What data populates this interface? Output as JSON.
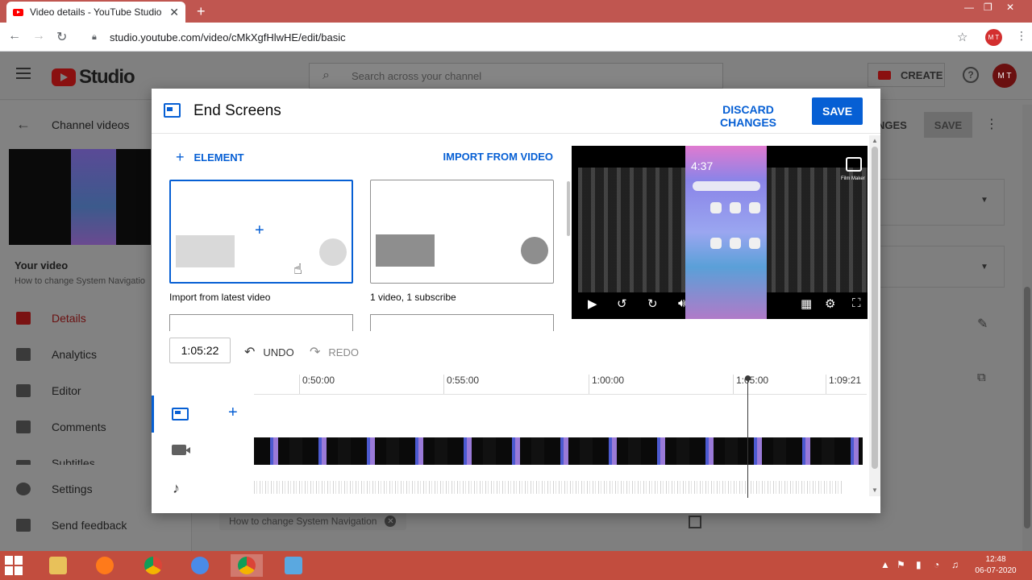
{
  "browser": {
    "tab_title": "Video details - YouTube Studio",
    "tab_close": "✕",
    "new_tab": "+",
    "url": "studio.youtube.com/video/cMkXgfHlwHE/edit/basic",
    "profile_initials": "M T"
  },
  "studio": {
    "logo_text": "Studio",
    "search_placeholder": "Search across your channel",
    "create_label": "CREATE",
    "help_icon": "?",
    "avatar_initials": "M T",
    "header_partial_label": "NGES",
    "header_save_label": "SAVE",
    "back_label": "Channel videos",
    "your_video_label": "Your video",
    "video_title_truncated": "How to change System Navigatio",
    "nav_items": [
      {
        "label": "Details",
        "icon": "pencil-icon",
        "active": true
      },
      {
        "label": "Analytics",
        "icon": "analytics-icon"
      },
      {
        "label": "Editor",
        "icon": "editor-icon"
      },
      {
        "label": "Comments",
        "icon": "comments-icon"
      },
      {
        "label": "Subtitles",
        "icon": "subtitles-icon"
      },
      {
        "label": "Settings",
        "icon": "gear-icon"
      },
      {
        "label": "Send feedback",
        "icon": "feedback-icon"
      }
    ],
    "tag_chip": "How to change System Navigation"
  },
  "modal": {
    "title": "End Screens",
    "discard_label": "DISCARD CHANGES",
    "save_label": "SAVE",
    "element_label": "ELEMENT",
    "import_label": "IMPORT FROM VIDEO",
    "templates": [
      {
        "caption": "Import from latest video",
        "selected": true
      },
      {
        "caption": "1 video, 1 subscribe",
        "selected": false
      }
    ],
    "preview": {
      "phone_time": "4:37",
      "watermark_text": "Film Maker"
    },
    "timeline": {
      "current_time": "1:05:22",
      "undo_label": "UNDO",
      "redo_label": "REDO",
      "ticks": [
        "0:50:00",
        "0:55:00",
        "1:00:00",
        "1:05:00",
        "1:09:21"
      ]
    }
  },
  "taskbar": {
    "time": "12:48",
    "date": "06-07-2020"
  },
  "colors": {
    "accent_blue": "#065fd4",
    "youtube_red": "#ff0000",
    "taskbar": "#c24d3e"
  }
}
